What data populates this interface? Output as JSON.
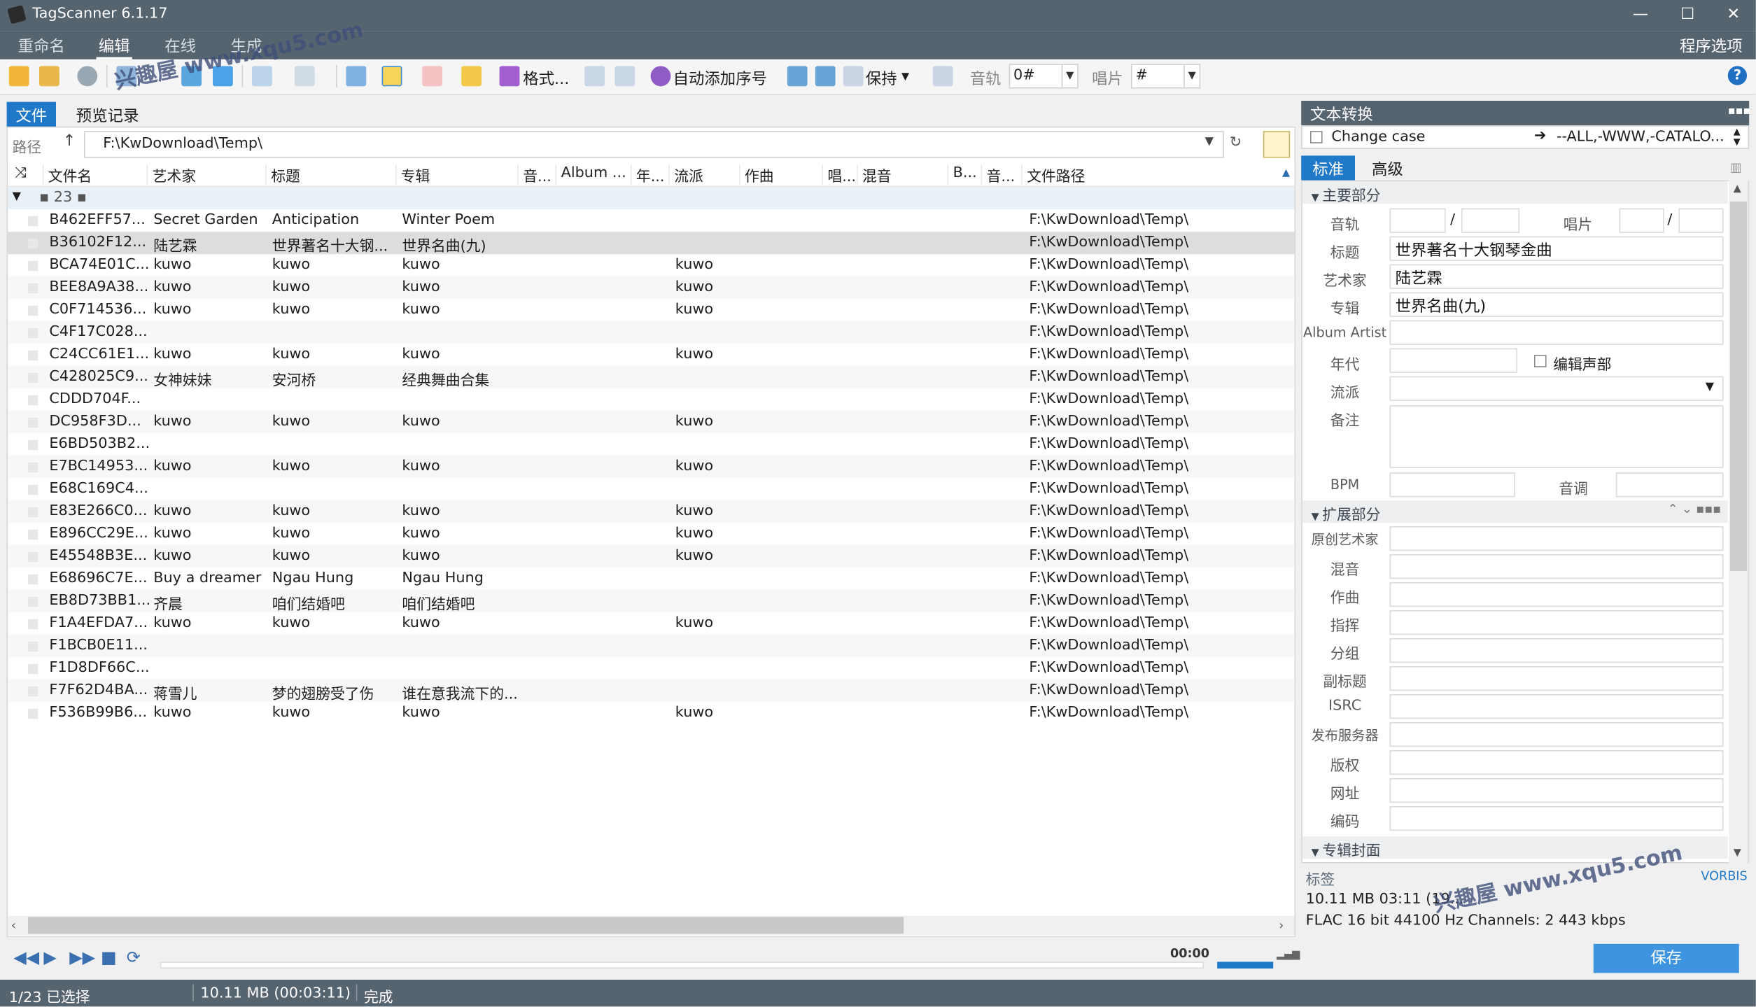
{
  "window": {
    "title": "TagScanner 6.1.17",
    "min": "—",
    "max": "☐",
    "close": "✕"
  },
  "menu": {
    "items": [
      "重命名",
      "编辑",
      "在线",
      "生成"
    ],
    "program_options": "程序选项"
  },
  "toolbar": {
    "format_label": "格式...",
    "auto_number_label": "自动添加序号",
    "keep_label": "保持",
    "track_label": "音轨",
    "track_value": "0#",
    "disc_label": "唱片",
    "disc_value": "#",
    "help": "?"
  },
  "left_tabs": {
    "file": "文件",
    "preview": "预览记录"
  },
  "path": {
    "label": "路径",
    "value": "F:\\KwDownload\\Temp\\"
  },
  "columns": [
    "文件名",
    "艺术家",
    "标题",
    "专辑",
    "音...",
    "Album ...",
    "年...",
    "流派",
    "作曲",
    "唱...",
    "混音",
    "B...",
    "音...",
    "文件路径"
  ],
  "group": {
    "label": "▪ 23 ▪"
  },
  "rows": [
    {
      "file": "B462EFF57...",
      "artist": "Secret Garden",
      "title": "Anticipation",
      "album": "Winter Poem",
      "genre": "",
      "path": "F:\\KwDownload\\Temp\\"
    },
    {
      "file": "B36102F12...",
      "artist": "陆艺霖",
      "title": "世界著名十大钢...",
      "album": "世界名曲(九)",
      "genre": "",
      "path": "F:\\KwDownload\\Temp\\"
    },
    {
      "file": "BCA74E01C...",
      "artist": "kuwo",
      "title": "kuwo",
      "album": "kuwo",
      "genre": "kuwo",
      "path": "F:\\KwDownload\\Temp\\"
    },
    {
      "file": "BEE8A9A38...",
      "artist": "kuwo",
      "title": "kuwo",
      "album": "kuwo",
      "genre": "kuwo",
      "path": "F:\\KwDownload\\Temp\\"
    },
    {
      "file": "C0F714536...",
      "artist": "kuwo",
      "title": "kuwo",
      "album": "kuwo",
      "genre": "kuwo",
      "path": "F:\\KwDownload\\Temp\\"
    },
    {
      "file": "C4F17C028...",
      "artist": "",
      "title": "",
      "album": "",
      "genre": "",
      "path": "F:\\KwDownload\\Temp\\"
    },
    {
      "file": "C24CC61E1...",
      "artist": "kuwo",
      "title": "kuwo",
      "album": "kuwo",
      "genre": "kuwo",
      "path": "F:\\KwDownload\\Temp\\"
    },
    {
      "file": "C428025C9...",
      "artist": "女神妹妹",
      "title": "安河桥",
      "album": "经典舞曲合集",
      "genre": "",
      "path": "F:\\KwDownload\\Temp\\"
    },
    {
      "file": "CDDD704F...",
      "artist": "",
      "title": "",
      "album": "",
      "genre": "",
      "path": "F:\\KwDownload\\Temp\\"
    },
    {
      "file": "DC958F3D...",
      "artist": "kuwo",
      "title": "kuwo",
      "album": "kuwo",
      "genre": "kuwo",
      "path": "F:\\KwDownload\\Temp\\"
    },
    {
      "file": "E6BD503B2...",
      "artist": "",
      "title": "",
      "album": "",
      "genre": "",
      "path": "F:\\KwDownload\\Temp\\"
    },
    {
      "file": "E7BC14953...",
      "artist": "kuwo",
      "title": "kuwo",
      "album": "kuwo",
      "genre": "kuwo",
      "path": "F:\\KwDownload\\Temp\\"
    },
    {
      "file": "E68C169C4...",
      "artist": "",
      "title": "",
      "album": "",
      "genre": "",
      "path": "F:\\KwDownload\\Temp\\"
    },
    {
      "file": "E83E266C0...",
      "artist": "kuwo",
      "title": "kuwo",
      "album": "kuwo",
      "genre": "kuwo",
      "path": "F:\\KwDownload\\Temp\\"
    },
    {
      "file": "E896CC29E...",
      "artist": "kuwo",
      "title": "kuwo",
      "album": "kuwo",
      "genre": "kuwo",
      "path": "F:\\KwDownload\\Temp\\"
    },
    {
      "file": "E45548B3E...",
      "artist": "kuwo",
      "title": "kuwo",
      "album": "kuwo",
      "genre": "kuwo",
      "path": "F:\\KwDownload\\Temp\\"
    },
    {
      "file": "E68696C7E...",
      "artist": "Buy a dreamer",
      "title": "Ngau Hung",
      "album": "Ngau Hung",
      "genre": "",
      "path": "F:\\KwDownload\\Temp\\"
    },
    {
      "file": "EB8D73BB1...",
      "artist": "齐晨",
      "title": "咱们结婚吧",
      "album": "咱们结婚吧",
      "genre": "",
      "path": "F:\\KwDownload\\Temp\\"
    },
    {
      "file": "F1A4EFDA7...",
      "artist": "kuwo",
      "title": "kuwo",
      "album": "kuwo",
      "genre": "kuwo",
      "path": "F:\\KwDownload\\Temp\\"
    },
    {
      "file": "F1BCB0E11...",
      "artist": "",
      "title": "",
      "album": "",
      "genre": "",
      "path": "F:\\KwDownload\\Temp\\"
    },
    {
      "file": "F1D8DF66C...",
      "artist": "",
      "title": "",
      "album": "",
      "genre": "",
      "path": "F:\\KwDownload\\Temp\\"
    },
    {
      "file": "F7F62D4BA...",
      "artist": "蒋雪儿",
      "title": "梦的翅膀受了伤",
      "album": "谁在意我流下的...",
      "genre": "",
      "path": "F:\\KwDownload\\Temp\\"
    },
    {
      "file": "F536B99B6...",
      "artist": "kuwo",
      "title": "kuwo",
      "album": "kuwo",
      "genre": "kuwo",
      "path": "F:\\KwDownload\\Temp\\"
    }
  ],
  "player": {
    "time": "00:00"
  },
  "status": {
    "selection": "1/23 已选择",
    "size": "10.11 MB (00:03:11)",
    "state": "完成"
  },
  "right": {
    "header": "文本转换",
    "case_label": "Change case",
    "case_rule": "--ALL,-WWW,-CATALO...",
    "tab_standard": "标准",
    "tab_advanced": "高级",
    "section_main": "主要部分",
    "section_ext": "扩展部分",
    "section_cover": "专辑封面",
    "labels": {
      "track": "音轨",
      "disc": "唱片",
      "title": "标题",
      "artist": "艺术家",
      "album": "专辑",
      "album_artist": "Album Artist",
      "year": "年代",
      "edit_voice": "编辑声部",
      "genre": "流派",
      "comment": "备注",
      "bpm": "BPM",
      "key": "音调"
    },
    "values": {
      "title": "世界著名十大钢琴金曲",
      "artist": "陆艺霖",
      "album": "世界名曲(九)"
    },
    "ext_labels": [
      "原创艺术家",
      "混音",
      "作曲",
      "指挥",
      "分组",
      "副标题",
      "ISRC",
      "发布服务器",
      "版权",
      "网址",
      "编码"
    ],
    "tag_label": "标签",
    "tag_format": "VORBIS",
    "info_line1": "10.11 MB  03:11 (19...",
    "info_line2": "FLAC  16 bit  44100 Hz  Channels: 2  443 kbps",
    "save": "保存"
  },
  "watermark": "兴趣屋 www.xqu5.com"
}
